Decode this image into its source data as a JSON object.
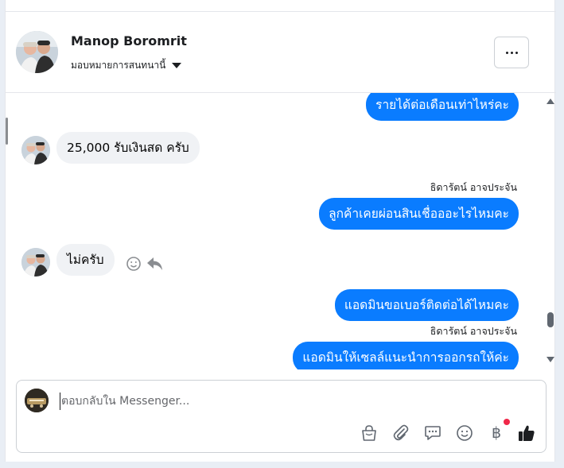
{
  "header": {
    "contact_name": "Manop Boromrit",
    "assign_label": "มอบหมายการสนทนานี้"
  },
  "messages": [
    {
      "direction": "out",
      "text": "รายได้ต่อเดือนเท่าไหร่คะ"
    },
    {
      "direction": "in",
      "text": "25,000 รับเงินสด ครับ"
    },
    {
      "direction": "out",
      "sender": "ธิดารัตน์ อาจประจัน",
      "text": "ลูกค้าเคยผ่อนสินเชื่อออะไรไหมคะ"
    },
    {
      "direction": "in",
      "text": "ไม่ครับ"
    },
    {
      "direction": "out",
      "text": "แอดมินขอเบอร์ติดต่อได้ไหมคะ"
    },
    {
      "direction": "out",
      "sender": "ธิดารัตน์ อาจประจัน",
      "text": "แอดมินให้เซลล์แนะนำการออกรถให้ค่ะ"
    }
  ],
  "composer": {
    "placeholder": "ตอบกลับใน Messenger..."
  },
  "icons": {
    "more": "more-options-icon",
    "react": "smile-react-icon",
    "reply": "reply-arrow-icon",
    "shop": "shopping-bag-icon",
    "attach": "paperclip-icon",
    "saved_replies": "chat-bubble-icon",
    "emoji": "emoji-icon",
    "payment": "baht-payment-icon",
    "like": "thumbs-up-icon"
  },
  "colors": {
    "outgoing_bubble": "#0a7cff",
    "incoming_bubble": "#f0f2f5",
    "notification_dot": "#f02849"
  }
}
